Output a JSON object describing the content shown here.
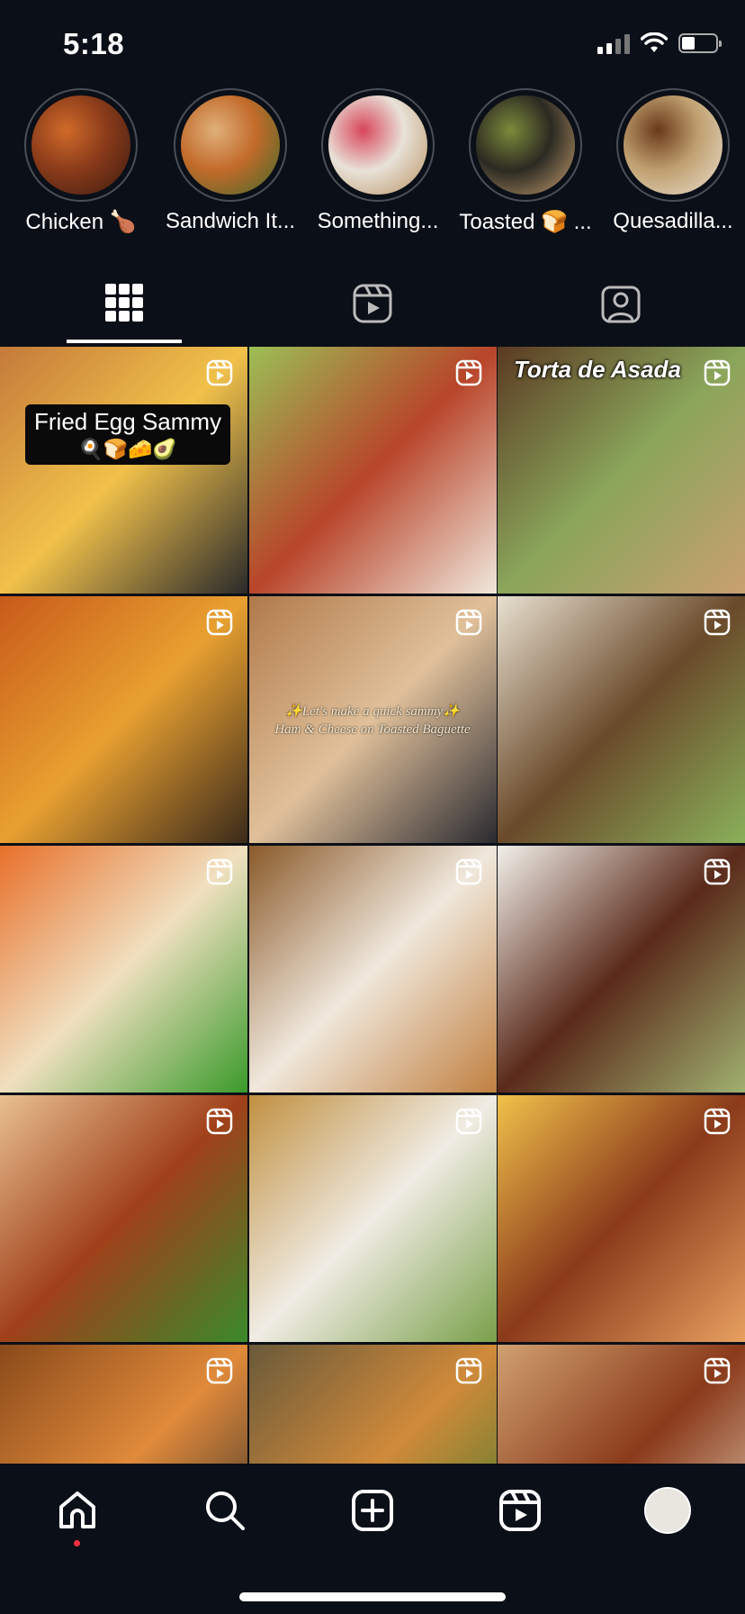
{
  "status": {
    "time": "5:18"
  },
  "highlights": [
    {
      "label": "Chicken 🍗",
      "colors": [
        "#8a3b1a",
        "#d06a2a",
        "#3a1a10"
      ]
    },
    {
      "label": "Sandwich It...",
      "colors": [
        "#c26a2a",
        "#e0b07a",
        "#3f6b2a"
      ]
    },
    {
      "label": "Something...",
      "colors": [
        "#e8e2d8",
        "#d9465a",
        "#b89060"
      ]
    },
    {
      "label": "Toasted 🍞 ...",
      "colors": [
        "#2b2a22",
        "#7d8a3a",
        "#c9a070"
      ]
    },
    {
      "label": "Quesadilla...",
      "colors": [
        "#c0a070",
        "#6a3a1a",
        "#e8e0d0"
      ]
    }
  ],
  "tabs": [
    {
      "name": "grid-tab",
      "icon": "grid-icon",
      "active": true
    },
    {
      "name": "reels-tab",
      "icon": "reels-icon",
      "active": false
    },
    {
      "name": "tagged-tab",
      "icon": "tagged-person-icon",
      "active": false
    }
  ],
  "posts": [
    {
      "colors": [
        "#c47a3a",
        "#f1c14a",
        "#2a2a2a"
      ],
      "overlay_title": "Fried Egg Sammy",
      "overlay_emoji": "🍳🍞🧀🥑"
    },
    {
      "colors": [
        "#9bbf55",
        "#b8452a",
        "#f0e8dc"
      ]
    },
    {
      "colors": [
        "#5a3a22",
        "#8aa55a",
        "#c9a070"
      ],
      "overlay_heading": "Torta de Asada"
    },
    {
      "colors": [
        "#c85a1a",
        "#e8a030",
        "#3a2a1a"
      ]
    },
    {
      "colors": [
        "#b07a4a",
        "#e0c09a",
        "#2a2a30"
      ],
      "overlay_line1": "✨Let's make a quick sammy✨",
      "overlay_line2": "Ham & Cheese on Toasted Baguette"
    },
    {
      "colors": [
        "#e8e0d0",
        "#6a4a2a",
        "#8ab05a"
      ]
    },
    {
      "colors": [
        "#e8702a",
        "#f0e0c0",
        "#3a9a2a"
      ]
    },
    {
      "colors": [
        "#8a5a2a",
        "#f0e8dc",
        "#c08040"
      ]
    },
    {
      "colors": [
        "#f2f0ea",
        "#5a2a1a",
        "#a0b070"
      ]
    },
    {
      "colors": [
        "#e8c090",
        "#a0401a",
        "#3a8a2a"
      ]
    },
    {
      "colors": [
        "#c09040",
        "#f0ece4",
        "#7aa04a"
      ]
    },
    {
      "colors": [
        "#f1c14a",
        "#8a3a1a",
        "#e8a060"
      ]
    },
    {
      "colors": [
        "#8a4a1a",
        "#e08a3a",
        "#2a2a2a"
      ]
    },
    {
      "colors": [
        "#6a5a3a",
        "#d08a3a",
        "#3a7a2a"
      ]
    },
    {
      "colors": [
        "#d0a070",
        "#8a3a1a",
        "#e8d8c0"
      ]
    }
  ],
  "bottom_nav": [
    {
      "name": "home-tab",
      "icon": "home-icon"
    },
    {
      "name": "search-tab",
      "icon": "search-icon"
    },
    {
      "name": "create-tab",
      "icon": "create-icon"
    },
    {
      "name": "reels-nav-tab",
      "icon": "reels-icon"
    },
    {
      "name": "profile-tab",
      "icon": "profile-avatar"
    }
  ]
}
